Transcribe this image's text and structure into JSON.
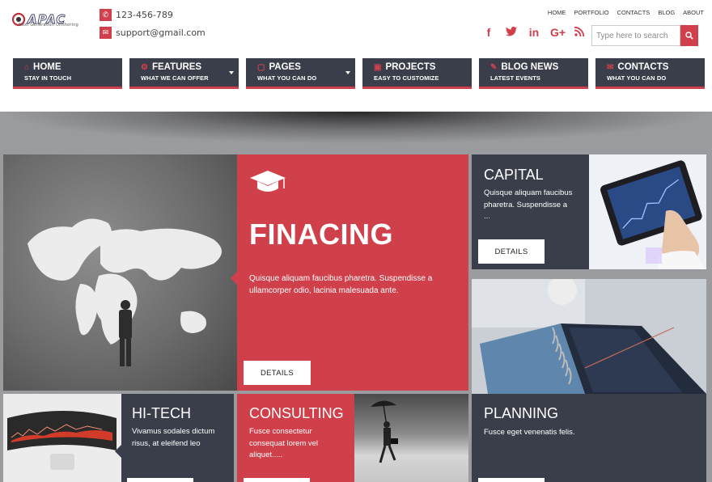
{
  "brand": {
    "logo_text": "APAC",
    "tagline": "Next Generation Offshoring",
    "accent": "#d0404c",
    "dark": "#3a3e4a"
  },
  "contact": {
    "phone": "123-456-789",
    "email": "support@gmail.com"
  },
  "top_links": [
    "HOME",
    "PORTFOLIO",
    "CONTACTS",
    "BLOG",
    "ABOUT"
  ],
  "social": [
    "facebook-icon",
    "twitter-icon",
    "linkedin-icon",
    "googleplus-icon",
    "rss-icon"
  ],
  "search": {
    "placeholder": "Type here to search"
  },
  "nav": [
    {
      "title": "HOME",
      "sub": "STAY IN TOUCH",
      "icon": "home-icon"
    },
    {
      "title": "FEATURES",
      "sub": "WHAT WE CAN OFFER",
      "icon": "gear-icon"
    },
    {
      "title": "PAGES",
      "sub": "WHAT YOU CAN DO",
      "icon": "file-icon"
    },
    {
      "title": "PROJECTS",
      "sub": "EASY TO CUSTOMIZE",
      "icon": "document-icon"
    },
    {
      "title": "BLOG NEWS",
      "sub": "LATEST EVENTS",
      "icon": "pencil-icon"
    },
    {
      "title": "CONTACTS",
      "sub": "WHAT YOU CAN DO",
      "icon": "envelope-icon"
    }
  ],
  "tiles": {
    "financing": {
      "title": "FINACING",
      "text": "Quisque aliquam faucibus pharetra. Suspendisse a ullamcorper odio, lacinia malesuada ante.",
      "button": "DETAILS"
    },
    "capital": {
      "title": "CAPITAL",
      "text": "Quisque aliquam faucibus pharetra. Suspendisse a ...",
      "button": "DETAILS"
    },
    "hitech": {
      "title": "HI-TECH",
      "text": "Vivamus sodales dictum risus, at eleifend leo"
    },
    "consulting": {
      "title": "CONSULTING",
      "text": "Fusce consectetur consequat lorem vel aliquet....."
    },
    "planning": {
      "title": "PLANNING",
      "text": "Fusce eget venenatis felis."
    }
  }
}
